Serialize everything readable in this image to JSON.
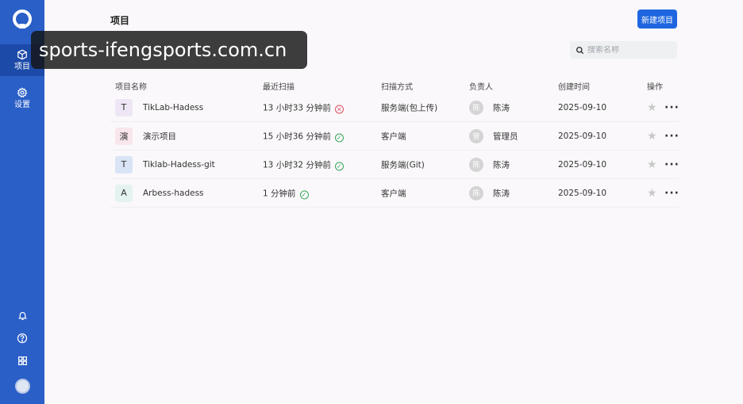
{
  "sidebar": {
    "items": [
      {
        "label": "项目",
        "icon": "cube-icon",
        "active": true
      },
      {
        "label": "设置",
        "icon": "gear-icon",
        "active": false
      }
    ],
    "bottom_icons": [
      "bell-icon",
      "help-icon",
      "apps-icon"
    ]
  },
  "header": {
    "title": "项目",
    "new_button": "新建项目"
  },
  "search": {
    "placeholder": "搜索名称"
  },
  "watermark": "sports-ifengsports.com.cn",
  "table": {
    "columns": [
      "项目名称",
      "最近扫描",
      "扫描方式",
      "负责人",
      "创建时间",
      "操作"
    ],
    "rows": [
      {
        "icon_char": "T",
        "icon_bg": "#efe6f5",
        "name": "TikLab-Hadess",
        "scan": "13 小时33 分钟前",
        "status": "error",
        "mode": "服务端(包上传)",
        "owner_avatar": "陈",
        "owner": "陈涛",
        "created": "2025-09-10"
      },
      {
        "icon_char": "演",
        "icon_bg": "#f8e6ec",
        "name": "演示项目",
        "scan": "15 小时36 分钟前",
        "status": "ok",
        "mode": "客户端",
        "owner_avatar": "管",
        "owner": "管理员",
        "created": "2025-09-10"
      },
      {
        "icon_char": "T",
        "icon_bg": "#d9e4f7",
        "name": "Tiklab-Hadess-git",
        "scan": "13 小时32 分钟前",
        "status": "ok",
        "mode": "服务端(Git)",
        "owner_avatar": "陈",
        "owner": "陈涛",
        "created": "2025-09-10"
      },
      {
        "icon_char": "A",
        "icon_bg": "#e4f3ef",
        "name": "Arbess-hadess",
        "scan": "1 分钟前",
        "status": "ok",
        "mode": "客户端",
        "owner_avatar": "陈",
        "owner": "陈涛",
        "created": "2025-09-10"
      }
    ]
  },
  "colors": {
    "sidebar": "#2a5fc7",
    "primary": "#1e66e0",
    "ok": "#36a85a",
    "error": "#e05060"
  }
}
